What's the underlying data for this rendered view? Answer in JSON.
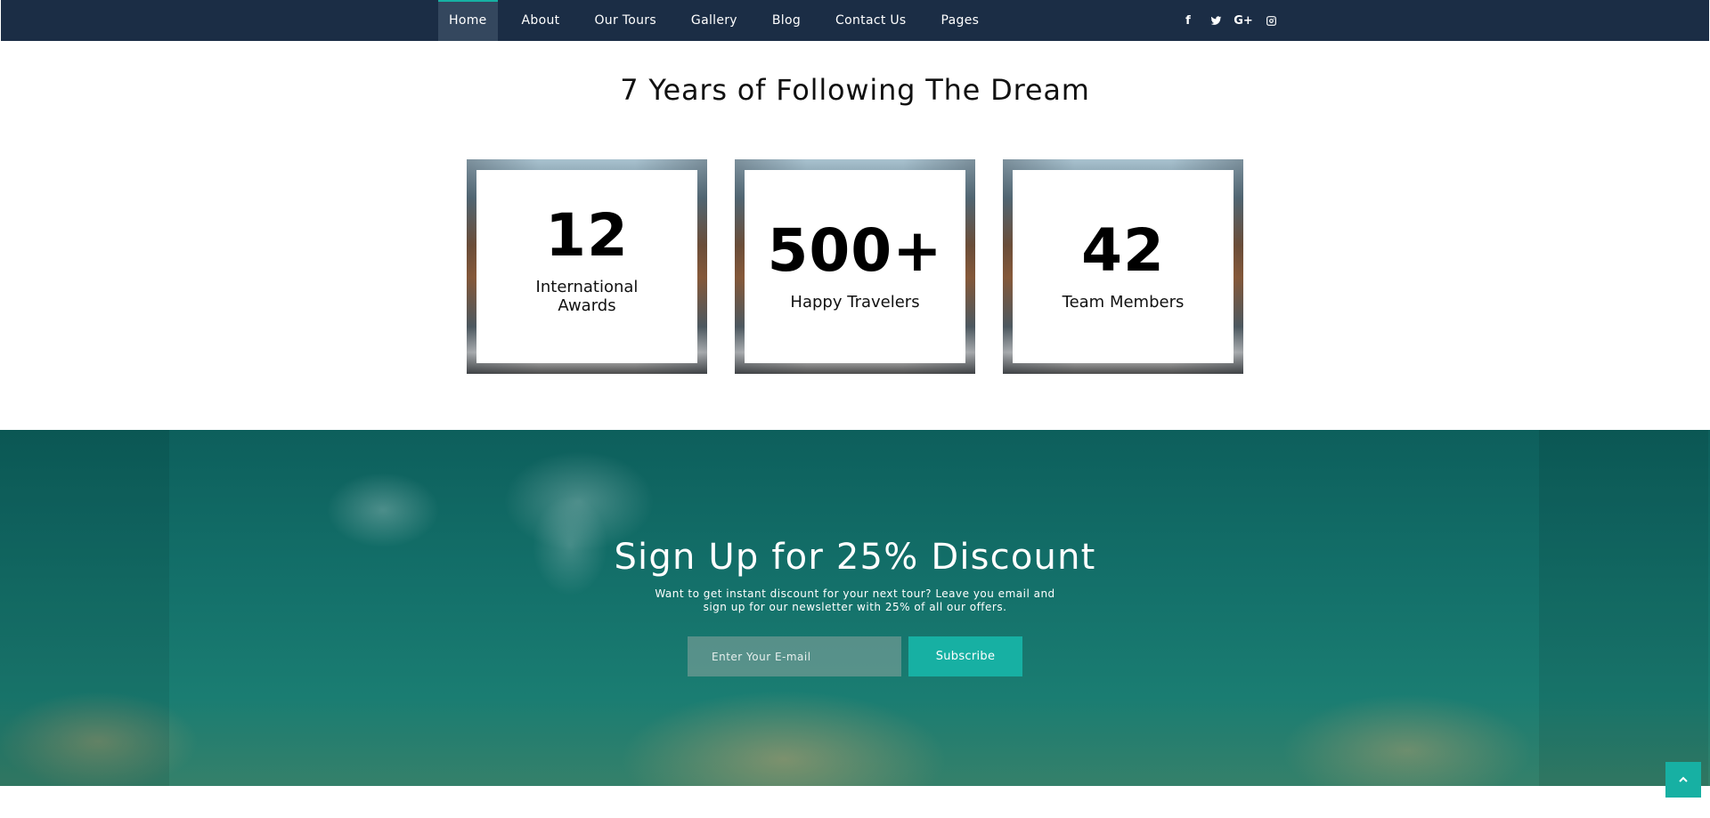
{
  "nav": {
    "items": [
      {
        "label": "Home",
        "active": true
      },
      {
        "label": "About"
      },
      {
        "label": "Our Tours"
      },
      {
        "label": "Gallery"
      },
      {
        "label": "Blog"
      },
      {
        "label": "Contact Us"
      },
      {
        "label": "Pages"
      }
    ],
    "social": [
      {
        "icon": "facebook-icon",
        "glyph": "f"
      },
      {
        "icon": "twitter-icon"
      },
      {
        "icon": "google-plus-icon",
        "glyph": "G+"
      },
      {
        "icon": "instagram-icon"
      }
    ]
  },
  "stats": {
    "title": "7 Years of Following The Dream",
    "items": [
      {
        "value": "12",
        "label": "International Awards"
      },
      {
        "value": "500+",
        "label": "Happy Travelers"
      },
      {
        "value": "42",
        "label": "Team Members"
      }
    ]
  },
  "signup": {
    "title": "Sign Up for 25% Discount",
    "description": "Want to get instant discount for your next tour? Leave you email and sign up for our newsletter with 25% of all our offers.",
    "email_placeholder": "Enter Your E-mail",
    "button_label": "Subscribe"
  },
  "back_to_top": {
    "icon": "chevron-up-icon"
  },
  "colors": {
    "nav_bg": "#1b2d45",
    "accent": "#17b0a3",
    "signup_bg": "#136f69"
  }
}
